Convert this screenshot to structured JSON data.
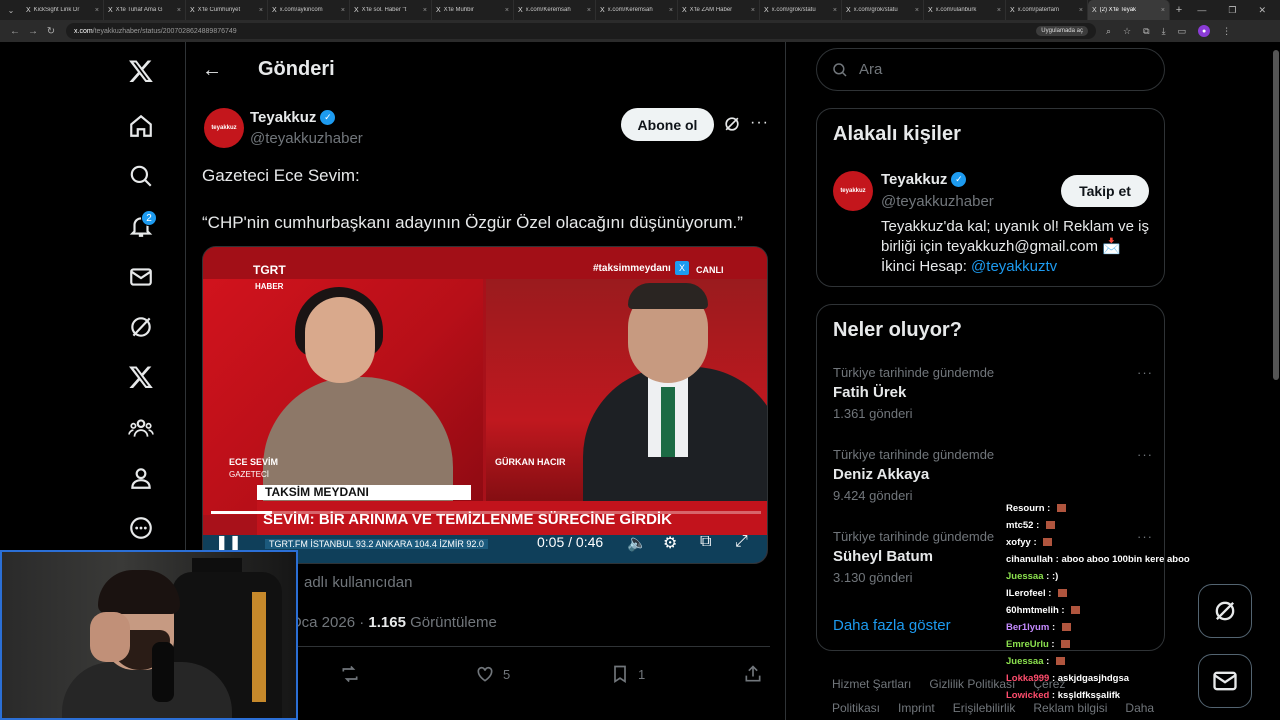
{
  "browser": {
    "tabs": [
      {
        "label": "KickSight Link Dr",
        "active": false
      },
      {
        "label": "X'te Tuhaf Ama G",
        "active": false
      },
      {
        "label": "X'te Cumhuriyet",
        "active": false
      },
      {
        "label": "x.com/aykiricom",
        "active": false
      },
      {
        "label": "X'te sol. Haber \"t",
        "active": false
      },
      {
        "label": "X'te Muhbir",
        "active": false
      },
      {
        "label": "x.com/Keremsah",
        "active": false
      },
      {
        "label": "x.com/Keremsah",
        "active": false
      },
      {
        "label": "X'te ZAM Haber",
        "active": false
      },
      {
        "label": "x.com/grok/statu",
        "active": false
      },
      {
        "label": "x.com/grok/statu",
        "active": false
      },
      {
        "label": "x.com/ulanburk",
        "active": false
      },
      {
        "label": "x.com/paterfam",
        "active": false
      },
      {
        "label": "(2) X'te Teyak",
        "active": true
      }
    ],
    "url_host": "x.com",
    "url_path": "/teyakkuzhaber/status/2007028624889876749",
    "open_in_app": "Uygulamada aç"
  },
  "nav": {
    "notifications_badge": "2"
  },
  "header": {
    "title": "Gönderi"
  },
  "tweet": {
    "avatar_text": "teyakkuz",
    "author_name": "Teyakkuz",
    "author_handle": "@teyakkuzhaber",
    "subscribe_label": "Abone ol",
    "line1": "Gazeteci Ece Sevim:",
    "line2": "“CHP'nin cumhurbaşkanı adayının Özgür Özel olacağını düşünüyorum.”",
    "video": {
      "channel": "TGRT",
      "channel_sub": "HABER",
      "hashtag": "#taksimmeydanı",
      "live": "CANLI",
      "left_name": "ECE SEVİM",
      "left_role": "GAZETECİ",
      "right_name": "GÜRKAN HACIR",
      "program": "TAKSİM MEYDANI",
      "headline": "SEVİM: BİR ARINMA VE TEMİZLENME SÜRECİNE GİRDİK",
      "ticker": "TGRT.FM  İSTANBUL 93.2   ANKARA 104.4   İZMİR 92.0",
      "time": "0:05 / 0:46",
      "progress": 0.11
    },
    "repost_note": "adlı kullanıcıdan",
    "date_partial": "Oca 2026 · ",
    "views": "1.165",
    "views_label": " Görüntüleme",
    "like_count": "5",
    "bookmark_count": "1"
  },
  "search": {
    "placeholder": "Ara"
  },
  "related": {
    "title": "Alakalı kişiler",
    "avatar_text": "teyakkuz",
    "name": "Teyakkuz",
    "handle": "@teyakkuzhaber",
    "follow_label": "Takip et",
    "bio": "Teyakkuz'da kal; uyanık ol! Reklam ve iş birliği için teyakkuzh@gmail.com 📩 İkinci Hesap: ",
    "bio_link": "@teyakkuztv"
  },
  "trends": {
    "title": "Neler oluyor?",
    "items": [
      {
        "context": "Türkiye tarihinde gündemde",
        "name": "Fatih Ürek",
        "count": "1.361 gönderi"
      },
      {
        "context": "Türkiye tarihinde gündemde",
        "name": "Deniz Akkaya",
        "count": "9.424 gönderi"
      },
      {
        "context": "Türkiye tarihinde gündemde",
        "name": "Süheyl Batum",
        "count": "3.130 gönderi"
      }
    ],
    "show_more": "Daha fazla göster"
  },
  "footer": {
    "links": [
      "Hizmet Şartları",
      "Gizlilik Politikası",
      "Çerez Politikası",
      "Imprint",
      "Erişilebilirlik",
      "Reklam bilgisi",
      "Daha fazla ..."
    ]
  },
  "chat": {
    "messages": [
      {
        "user": "Resourn",
        "text": "",
        "color": "#ffffff",
        "emote": true
      },
      {
        "user": "mtc52",
        "text": "",
        "color": "#ffffff",
        "emote": true
      },
      {
        "user": "xofyy",
        "text": "",
        "color": "#ffffff",
        "emote": true
      },
      {
        "user": "cihanullah",
        "text": "aboo aboo 100bin kere aboo",
        "color": "#ffffff",
        "emote": false
      },
      {
        "user": "Juessaa",
        "text": ":)",
        "color": "#8be04e",
        "emote": false
      },
      {
        "user": "ILerofeel",
        "text": "",
        "color": "#ffffff",
        "emote": true
      },
      {
        "user": "60hmtmelih",
        "text": "",
        "color": "#ffffff",
        "emote": true
      },
      {
        "user": "Ber1lyum",
        "text": "",
        "color": "#c58bff",
        "emote": true
      },
      {
        "user": "EmreUrlu",
        "text": "",
        "color": "#8be04e",
        "emote": true
      },
      {
        "user": "Juessaa",
        "text": "",
        "color": "#8be04e",
        "emote": true
      },
      {
        "user": "Lokka999",
        "text": "askjdgasjhdgsa",
        "color": "#ff4d6d",
        "emote": false
      },
      {
        "user": "Lowicked",
        "text": "ksşldfksşalifk",
        "color": "#ff4d6d",
        "emote": false
      }
    ]
  }
}
